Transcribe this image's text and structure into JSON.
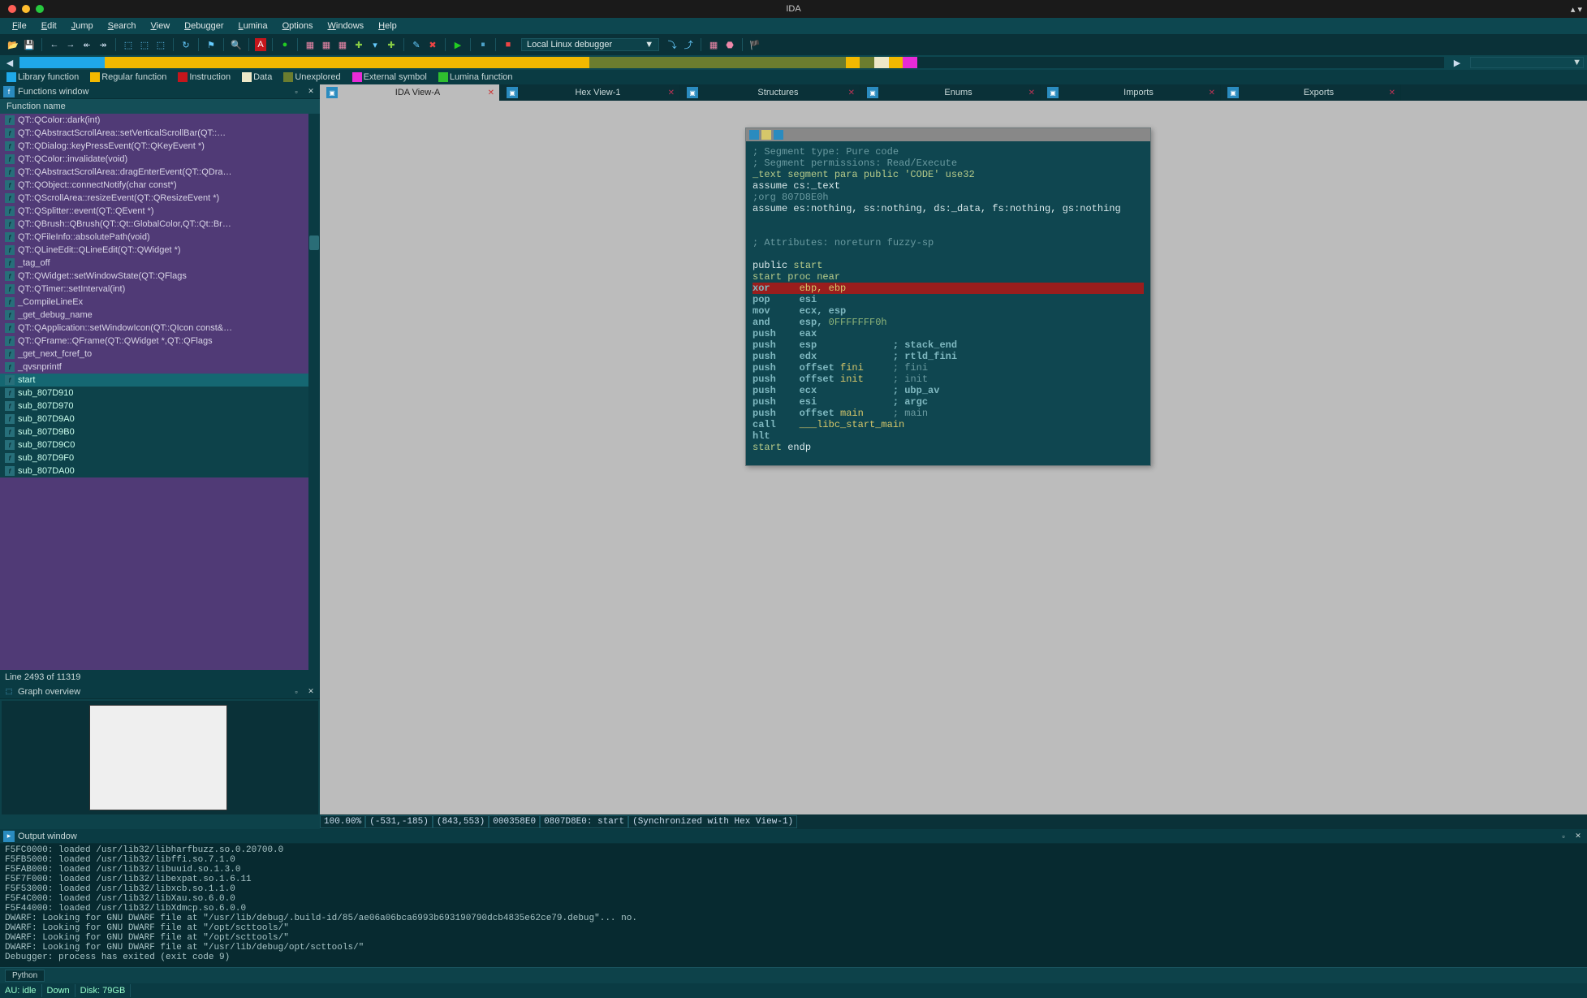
{
  "title": "IDA",
  "menus": [
    "File",
    "Edit",
    "Jump",
    "Search",
    "View",
    "Debugger",
    "Lumina",
    "Options",
    "Windows",
    "Help"
  ],
  "debugger_selected": "Local Linux debugger",
  "legend": [
    {
      "label": "Library function",
      "color": "#1fa8e8"
    },
    {
      "label": "Regular function",
      "color": "#f2b900"
    },
    {
      "label": "Instruction",
      "color": "#c4161c"
    },
    {
      "label": "Data",
      "color": "#eee8c8"
    },
    {
      "label": "Unexplored",
      "color": "#6b7d2f"
    },
    {
      "label": "External symbol",
      "color": "#e82bd7"
    },
    {
      "label": "Lumina function",
      "color": "#2fbf2f"
    }
  ],
  "panels": {
    "functions": "Functions window",
    "funccol": "Function name",
    "counter": "Line 2493 of 11319",
    "graph": "Graph overview",
    "output": "Output window"
  },
  "functions": [
    "QT::QColor::dark(int)",
    "QT::QAbstractScrollArea::setVerticalScrollBar(QT::…",
    "QT::QDialog::keyPressEvent(QT::QKeyEvent *)",
    "QT::QColor::invalidate(void)",
    "QT::QAbstractScrollArea::dragEnterEvent(QT::QDra…",
    "QT::QObject::connectNotify(char const*)",
    "QT::QScrollArea::resizeEvent(QT::QResizeEvent *)",
    "QT::QSplitter::event(QT::QEvent *)",
    "QT::QBrush::QBrush(QT::Qt::GlobalColor,QT::Qt::Br…",
    "QT::QFileInfo::absolutePath(void)",
    "QT::QLineEdit::QLineEdit(QT::QWidget *)",
    "_tag_off",
    "QT::QWidget::setWindowState(QT::QFlags<QT::Qt::…",
    "QT::QTimer::setInterval(int)",
    "_CompileLineEx",
    "_get_debug_name",
    "QT::QApplication::setWindowIcon(QT::QIcon const&…",
    "QT::QFrame::QFrame(QT::QWidget *,QT::QFlags<Q…",
    "_get_next_fcref_to",
    "_qvsnprintf"
  ],
  "selected_fn": "start",
  "subs": [
    "sub_807D910",
    "sub_807D970",
    "sub_807D9A0",
    "sub_807D9B0",
    "sub_807D9C0",
    "sub_807D9F0",
    "sub_807DA00"
  ],
  "tabs": [
    {
      "label": "IDA View-A",
      "active": true
    },
    {
      "label": "Hex View-1"
    },
    {
      "label": "Structures"
    },
    {
      "label": "Enums"
    },
    {
      "label": "Imports"
    },
    {
      "label": "Exports"
    }
  ],
  "asm": {
    "l1": "; Segment type: Pure code",
    "l2": "; Segment permissions: Read/Execute",
    "l3": "_text segment para public 'CODE' use32",
    "l4": "assume cs:_text",
    "l5": ";org 807D8E0h",
    "l6": "assume es:nothing, ss:nothing, ds:_data, fs:nothing, gs:nothing",
    "l7": "; Attributes: noreturn fuzzy-sp",
    "l8a": "public ",
    "l8b": "start",
    "l9": "start proc near",
    "l10": "xor     ebp, ebp",
    "l11": "pop     esi",
    "l12": "mov     ecx, esp",
    "l13a": "and     esp, ",
    "l13b": "0FFFFFFF0h",
    "l14": "push    eax",
    "l15": "push    esp             ; stack_end",
    "l16": "push    edx             ; rtld_fini",
    "l17a": "push    offset ",
    "l17b": "fini",
    "l17c": "     ; fini",
    "l18a": "push    offset ",
    "l18b": "init",
    "l18c": "     ; init",
    "l19": "push    ecx             ; ubp_av",
    "l20": "push    esi             ; argc",
    "l21a": "push    offset ",
    "l21b": "main",
    "l21c": "     ; main",
    "l22a": "call    ",
    "l22b": "___libc_start_main",
    "l23": "hlt",
    "l24a": "start ",
    "l24b": "endp"
  },
  "status": {
    "zoom": "100.00%",
    "c1": "(-531,-185)",
    "c2": "(843,553)",
    "off": "000358E0",
    "addr": "0807D8E0: start",
    "sync": "(Synchronized with Hex View-1)"
  },
  "output_lines": [
    "F5FC0000: loaded /usr/lib32/libharfbuzz.so.0.20700.0",
    "F5FB5000: loaded /usr/lib32/libffi.so.7.1.0",
    "F5FAB000: loaded /usr/lib32/libuuid.so.1.3.0",
    "F5F7F000: loaded /usr/lib32/libexpat.so.1.6.11",
    "F5F53000: loaded /usr/lib32/libxcb.so.1.1.0",
    "F5F4C000: loaded /usr/lib32/libXau.so.6.0.0",
    "F5F44000: loaded /usr/lib32/libXdmcp.so.6.0.0",
    "DWARF: Looking for GNU DWARF file at \"/usr/lib/debug/.build-id/85/ae06a06bca6993b693190790dcb4835e62ce79.debug\"... no.",
    "DWARF: Looking for GNU DWARF file at \"/opt/scttools/\"",
    "DWARF: Looking for GNU DWARF file at \"/opt/scttools/\"",
    "DWARF: Looking for GNU DWARF file at \"/usr/lib/debug/opt/scttools/\"",
    "Debugger: process has exited (exit code 9)"
  ],
  "py": "Python",
  "sb": {
    "au": "AU:  idle",
    "down": "Down",
    "disk": "Disk: 79GB"
  }
}
